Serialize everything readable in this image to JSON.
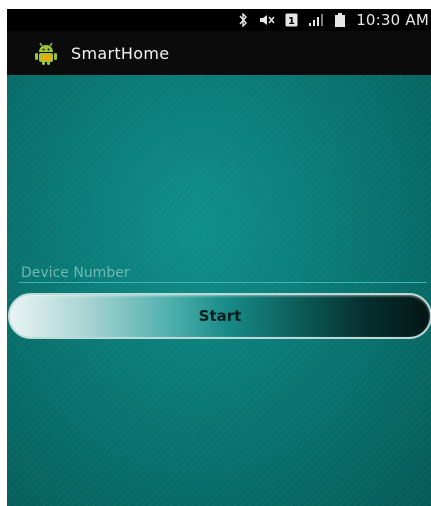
{
  "status_bar": {
    "icons": [
      "bluetooth-icon",
      "mute-icon",
      "sim-icon",
      "signal-icon",
      "battery-icon"
    ],
    "sim_label": "1",
    "time": "10:30 AM"
  },
  "action_bar": {
    "app_icon": "android-robot-icon",
    "title": "SmartHome"
  },
  "form": {
    "device_number": {
      "value": "",
      "placeholder": "Device Number"
    },
    "start_button_label": "Start"
  },
  "colors": {
    "background": "#0a7673",
    "accent": "#3fb6b3",
    "title_text": "#f2f2f2"
  }
}
